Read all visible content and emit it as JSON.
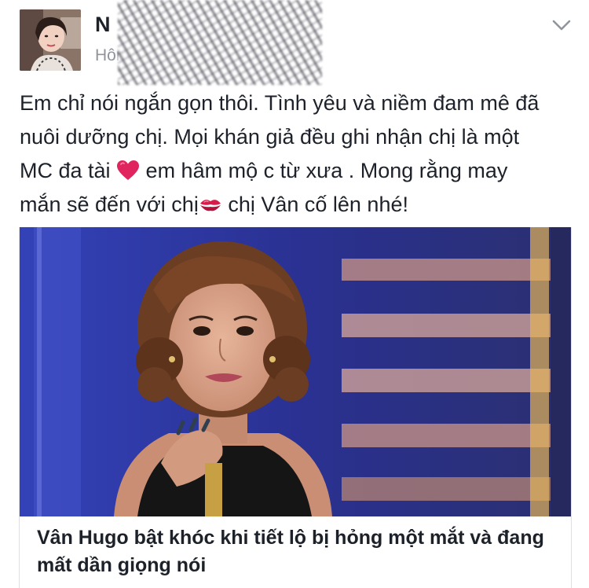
{
  "post": {
    "author_name": "N",
    "timestamp": "Hôm",
    "menu_icon": "chevron-down-icon",
    "text_lines": [
      "Em chỉ nói ngắn gọn thôi. Tình yêu và niềm đam mê đã",
      "nuôi dưỡng chị. Mọi khán giả đều ghi nhận chị là một"
    ],
    "line3_before": "MC đa tài ",
    "line3_after": " em hâm mộ c từ xưa . Mong rằng may",
    "line4_before": "mắn sẽ đến với chị",
    "line4_after": " chị Vân cố lên nhé!",
    "emoji_heart": "red-heart-icon",
    "emoji_kiss": "kiss-mark-icon"
  },
  "link_preview": {
    "title": "Vân Hugo bật khóc khi tiết lộ bị hỏng một mắt và đang mất dần giọng nói"
  },
  "colors": {
    "text": "#1d2129",
    "secondary_text": "#90949c",
    "heart": "#e0245e",
    "stage_blue": "#2e3b9e"
  }
}
